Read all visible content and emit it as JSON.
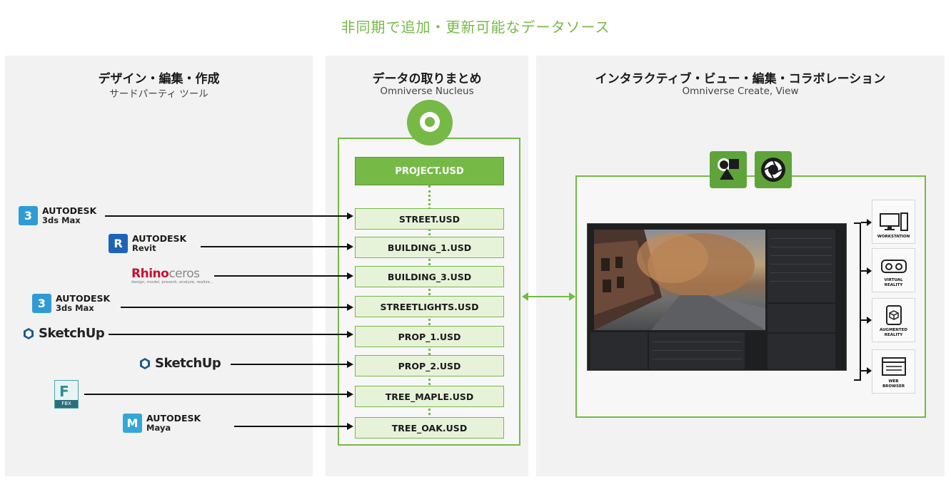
{
  "title": "非同期で追加・更新可能なデータソース",
  "left_panel": {
    "title": "デザイン・編集・作成",
    "subtitle": "サードパーティ ツール"
  },
  "middle_panel": {
    "title": "データの取りまとめ",
    "subtitle": "Omniverse Nucleus"
  },
  "right_panel": {
    "title": "インタラクティブ・ビュー・編集・コラボレーション",
    "subtitle": "Omniverse Create, View"
  },
  "project_file": "PROJECT.USD",
  "usd_files": [
    "STREET.USD",
    "BUILDING_1.USD",
    "BUILDING_3.USD",
    "STREETLIGHTS.USD",
    "PROP_1.USD",
    "PROP_2.USD",
    "TREE_MAPLE.USD",
    "TREE_OAK.USD"
  ],
  "tools": [
    {
      "brand": "AUTODESK",
      "product": "3ds Max",
      "icon_letter": "3"
    },
    {
      "brand": "AUTODESK",
      "product": "Revit",
      "icon_letter": "R"
    },
    {
      "brand": "Rhino",
      "brand2": "ceros",
      "tagline": "design, model, present, analyze, realize..."
    },
    {
      "brand": "AUTODESK",
      "product": "3ds Max",
      "icon_letter": "3"
    },
    {
      "brand": "SketchUp"
    },
    {
      "brand": "SketchUp"
    },
    {
      "icon_letter": "F",
      "label": "FBX"
    },
    {
      "brand": "AUTODESK",
      "product": "Maya",
      "icon_letter": "M"
    }
  ],
  "devices": [
    {
      "label": "WORKSTATION",
      "icon": "workstation-icon"
    },
    {
      "label": "VIRTUAL\nREALITY",
      "icon": "vr-headset-icon"
    },
    {
      "label": "AUGMENTED\nREALITY",
      "icon": "ar-cube-icon"
    },
    {
      "label": "WEB\nBROWSER",
      "icon": "web-browser-icon"
    }
  ],
  "colors": {
    "accent": "#76b947",
    "title": "#76b947",
    "panel": "#f2f2f2"
  }
}
